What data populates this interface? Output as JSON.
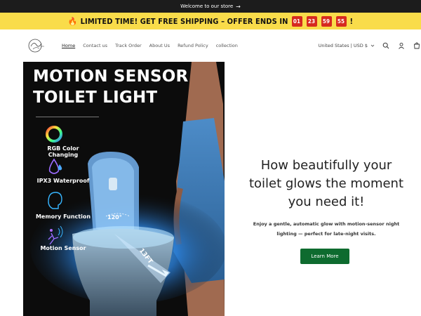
{
  "announcement": {
    "text": "Welcome to our store",
    "arrow": "→"
  },
  "promo": {
    "fire": "🔥",
    "text": "LIMITED TIME! GET FREE SHIPPING – OFFER ENDS IN",
    "countdown": [
      "01",
      "23",
      "59",
      "55"
    ],
    "end": "!"
  },
  "nav": {
    "items": [
      {
        "label": "Home"
      },
      {
        "label": "Contact us"
      },
      {
        "label": "Track Order"
      },
      {
        "label": "About Us"
      },
      {
        "label": "Refund Policy"
      },
      {
        "label": "collection"
      }
    ],
    "country": "United States | USD $"
  },
  "hero_image": {
    "title_line1": "MOTION SENSOR",
    "title_line2": "TOILET LIGHT",
    "features": [
      {
        "label": "RGB Color Changing"
      },
      {
        "label": "IPX3 Waterproof"
      },
      {
        "label": "Memory Function"
      },
      {
        "label": "Motion Sensor"
      }
    ],
    "angle": "120°",
    "distance": "13FT"
  },
  "hero_text": {
    "headline": "How beautifully your toilet glows the moment you need it!",
    "subtext": "Enjoy a gentle, automatic glow with motion-sensor night lighting — perfect for late-night visits.",
    "cta": "Learn More"
  },
  "colors": {
    "accent": "#0e6b2f",
    "promo_bg": "#f9dc4a",
    "countdown_bg": "#d62a1f"
  }
}
